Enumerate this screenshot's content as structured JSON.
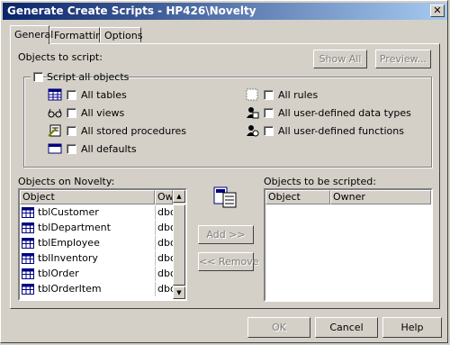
{
  "window": {
    "title": "Generate Create Scripts - HP426\\Novelty"
  },
  "tabs": [
    {
      "label": "General"
    },
    {
      "label": "Formatting"
    },
    {
      "label": "Options"
    }
  ],
  "top_buttons": {
    "show_all": "Show All",
    "preview": "Preview..."
  },
  "objects_to_script_label": "Objects to script:",
  "script_all_label": "Script all objects",
  "options_left": [
    {
      "label": "All tables",
      "icon": "table-icon"
    },
    {
      "label": "All views",
      "icon": "glasses-icon"
    },
    {
      "label": "All stored procedures",
      "icon": "script-icon"
    },
    {
      "label": "All defaults",
      "icon": "defaults-icon"
    }
  ],
  "options_right": [
    {
      "label": "All rules",
      "icon": "rule-icon"
    },
    {
      "label": "All user-defined data types",
      "icon": "user-type-icon"
    },
    {
      "label": "All user-defined functions",
      "icon": "user-function-icon"
    }
  ],
  "left_list": {
    "label": "Objects on Novelty:",
    "columns": [
      "Object",
      "Owner"
    ],
    "rows": [
      {
        "object": "tblCustomer",
        "owner": "dbo"
      },
      {
        "object": "tblDepartment",
        "owner": "dbo"
      },
      {
        "object": "tblEmployee",
        "owner": "dbo"
      },
      {
        "object": "tblInventory",
        "owner": "dbo"
      },
      {
        "object": "tblOrder",
        "owner": "dbo"
      },
      {
        "object": "tblOrderItem",
        "owner": "dbo"
      }
    ]
  },
  "right_list": {
    "label": "Objects to be scripted:",
    "columns": [
      "Object",
      "Owner"
    ]
  },
  "middle_buttons": {
    "add": "Add >>",
    "remove": "<< Remove"
  },
  "bottom_buttons": {
    "ok": "OK",
    "cancel": "Cancel",
    "help": "Help"
  }
}
